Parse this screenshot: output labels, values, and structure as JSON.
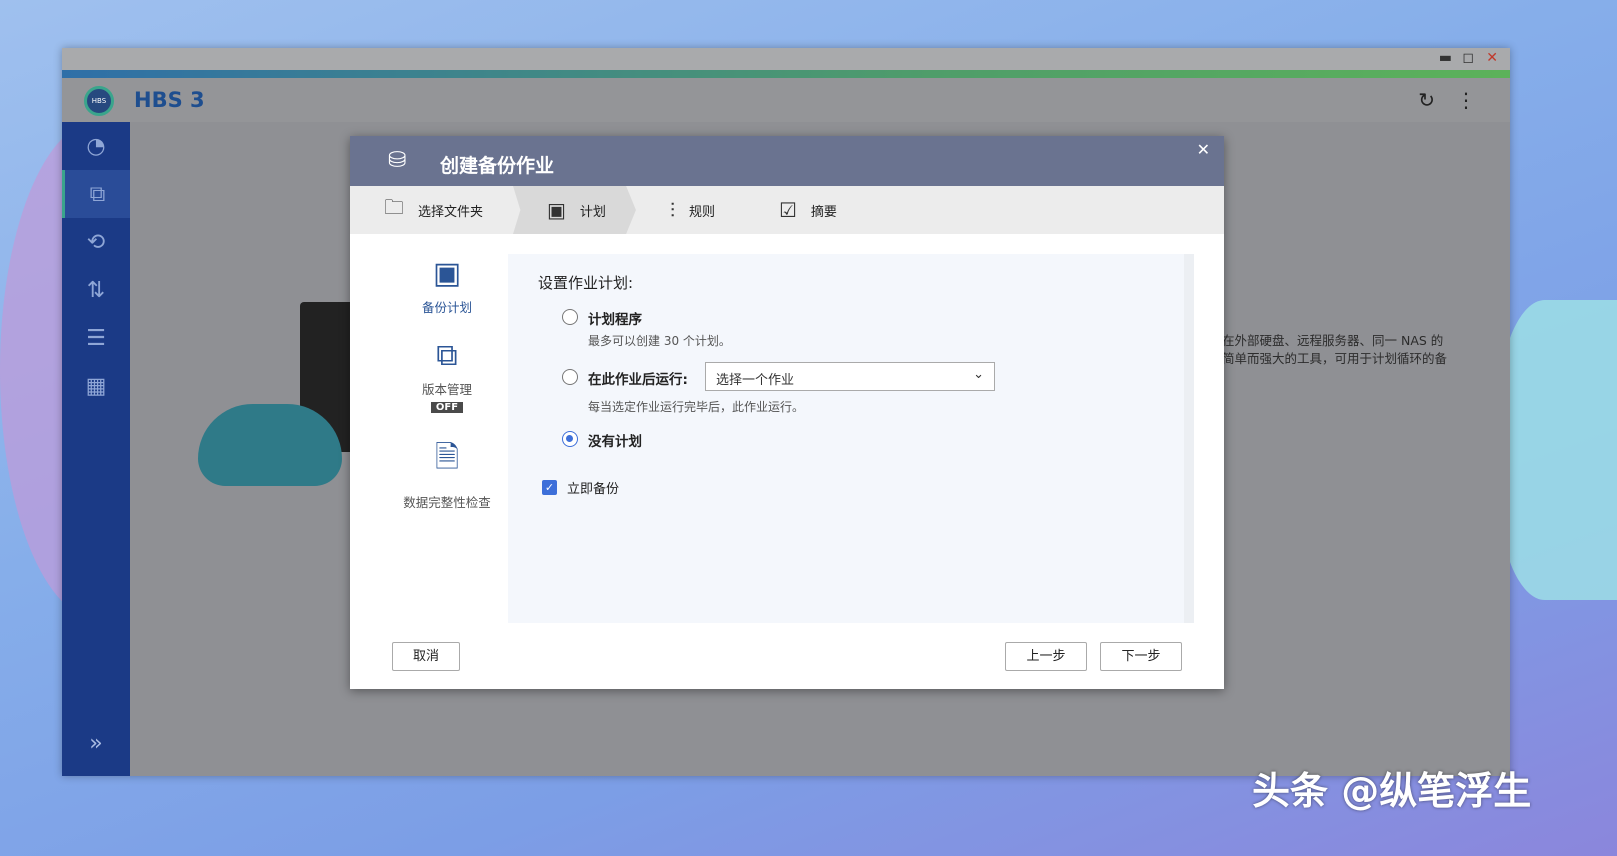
{
  "window": {
    "app_title": "HBS 3",
    "logo_text": "HBS"
  },
  "background_text": [
    "在外部硬盘、远程服务器、同一 NAS 的",
    "简单而强大的工具，可用于计划循环的备"
  ],
  "dialog": {
    "title": "创建备份作业",
    "steps": [
      {
        "label": "选择文件夹"
      },
      {
        "label": "计划"
      },
      {
        "label": "规则"
      },
      {
        "label": "摘要"
      }
    ],
    "left_nav": [
      {
        "label": "备份计划"
      },
      {
        "label": "版本管理",
        "badge": "OFF"
      },
      {
        "label": "数据完整性检查"
      }
    ],
    "panel": {
      "title": "设置作业计划:",
      "options": [
        {
          "label": "计划程序",
          "desc": "最多可以创建 30 个计划。",
          "selected": false
        },
        {
          "label": "在此作业后运行:",
          "desc": "每当选定作业运行完毕后，此作业运行。",
          "selected": false,
          "select_value": "选择一个作业"
        },
        {
          "label": "没有计划",
          "selected": true
        }
      ],
      "checkbox": {
        "label": "立即备份",
        "checked": true
      }
    },
    "buttons": {
      "cancel": "取消",
      "prev": "上一步",
      "next": "下一步"
    }
  },
  "watermark": "头条 @纵笔浮生"
}
